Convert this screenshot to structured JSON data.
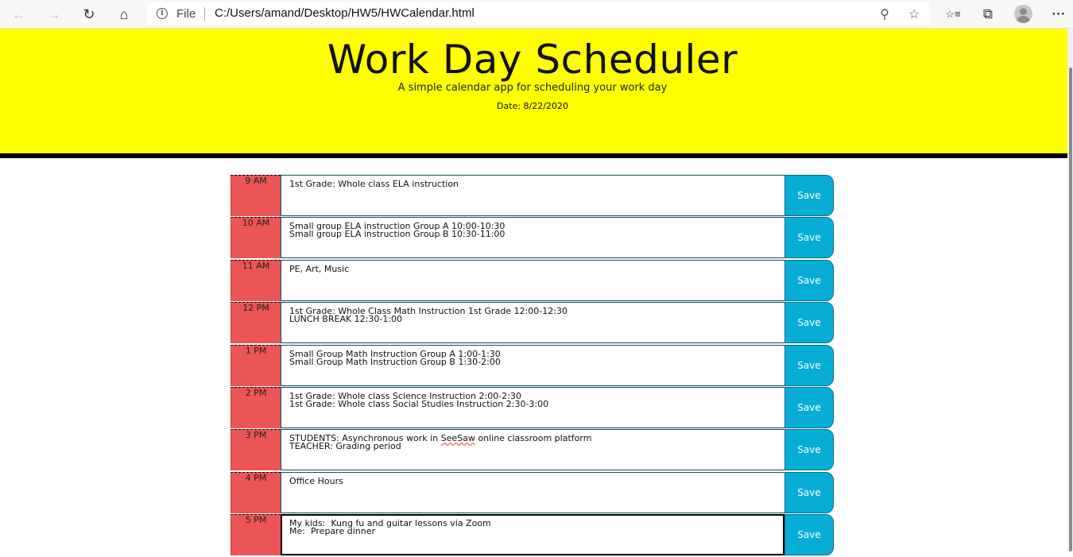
{
  "browser": {
    "file_label": "File",
    "url": "C:/Users/amand/Desktop/HW5/HWCalendar.html",
    "back_icon": "←",
    "forward_icon": "→",
    "refresh_icon": "↻",
    "home_icon": "⌂",
    "zoom_icon": "⚲",
    "star_icon": "☆",
    "favorites_icon": "☆≡",
    "collections_icon": "⧉",
    "more_icon": "···"
  },
  "header": {
    "title": "Work Day Scheduler",
    "subtitle": "A simple calendar app for scheduling your work day",
    "date": "Date: 8/22/2020",
    "background": "#ffff00"
  },
  "schedule": {
    "save_label": "Save",
    "colors": {
      "past": "#eb5555",
      "save": "#06aed5"
    },
    "rows": [
      {
        "hour": "9 AM",
        "text": "1st Grade: Whole class ELA instruction"
      },
      {
        "hour": "10 AM",
        "text": "Small group ELA instruction Group A 10:00-10:30\nSmall group ELA instruction Group B 10:30-11:00"
      },
      {
        "hour": "11 AM",
        "text": "PE, Art, Music"
      },
      {
        "hour": "12 PM",
        "text": "1st Grade: Whole Class Math Instruction 1st Grade 12:00-12:30\nLUNCH BREAK 12:30-1:00"
      },
      {
        "hour": "1 PM",
        "text": "Small Group Math Instruction Group A 1:00-1:30\nSmall Group Math Instruction Group B 1:30-2:00"
      },
      {
        "hour": "2 PM",
        "text": "1st Grade: Whole class Science Instruction 2:00-2:30\n1st Grade: Whole class Social Studies Instruction 2:30-3:00"
      },
      {
        "hour": "3 PM",
        "text_before": "STUDENTS: Asynchronous work in ",
        "text_spell": "SeeSaw",
        "text_after": " online classroom platform\nTEACHER: Grading period"
      },
      {
        "hour": "4 PM",
        "text": "Office Hours"
      },
      {
        "hour": "5 PM",
        "text": "My kids:  Kung fu and guitar lessons via Zoom\nMe:  Prepare dinner"
      }
    ]
  }
}
